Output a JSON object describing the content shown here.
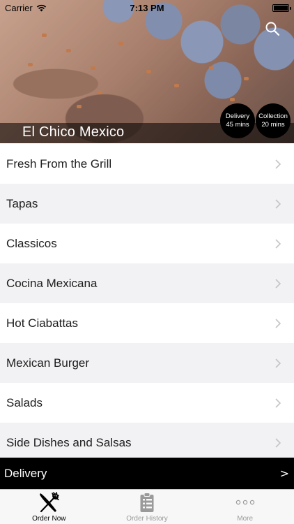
{
  "status_bar": {
    "carrier": "Carrier",
    "time": "7:13 PM"
  },
  "restaurant": {
    "name": "El Chico Mexico"
  },
  "badges": {
    "delivery": {
      "label": "Delivery",
      "time": "45 mins"
    },
    "collection": {
      "label": "Collection",
      "time": "20 mins"
    }
  },
  "menu": {
    "items": [
      {
        "label": "Fresh From the Grill"
      },
      {
        "label": "Tapas"
      },
      {
        "label": "Classicos"
      },
      {
        "label": "Cocina Mexicana"
      },
      {
        "label": "Hot Ciabattas"
      },
      {
        "label": "Mexican Burger"
      },
      {
        "label": "Salads"
      },
      {
        "label": "Side Dishes and Salsas"
      }
    ]
  },
  "delivery_bar": {
    "label": "Delivery",
    "arrow": ">"
  },
  "tab_bar": {
    "tabs": [
      {
        "label": "Order Now",
        "icon": "fork-knife-icon",
        "active": true
      },
      {
        "label": "Order History",
        "icon": "clipboard-icon",
        "active": false
      },
      {
        "label": "More",
        "icon": "more-dots-icon",
        "active": false
      }
    ]
  },
  "colors": {
    "accent_bar": "#000000",
    "row_alt": "#f2f2f4",
    "tab_inactive": "#9a9a9a"
  }
}
